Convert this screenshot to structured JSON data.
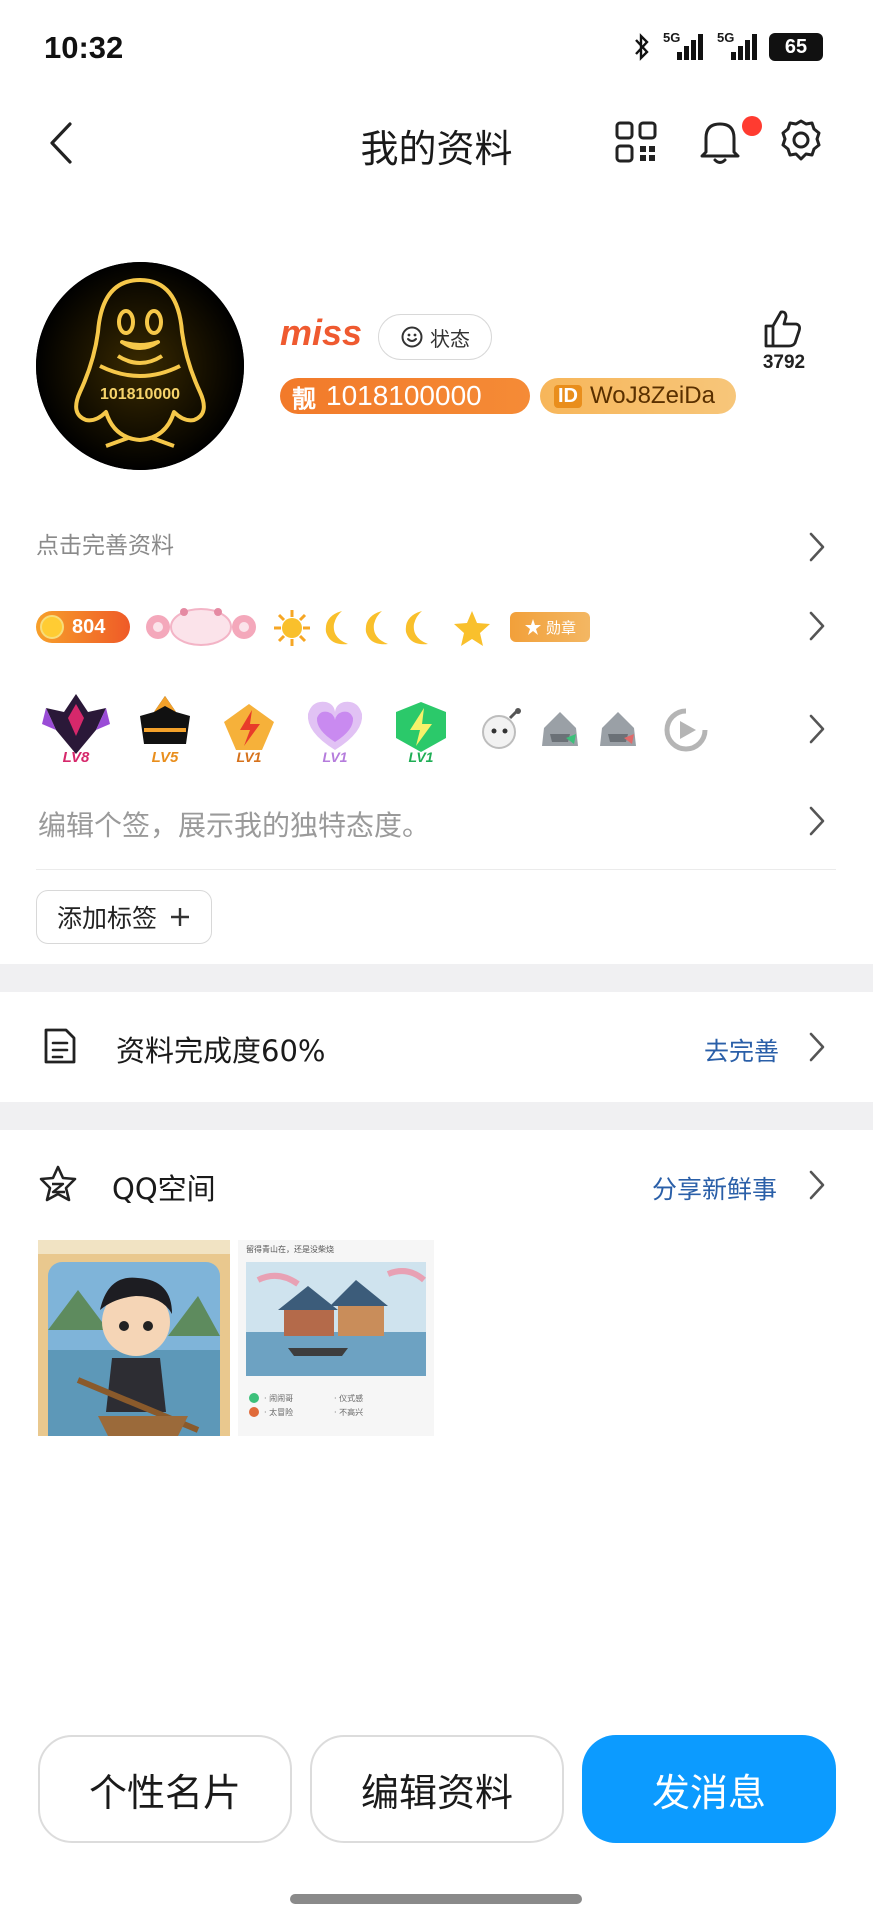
{
  "status_bar": {
    "time": "10:32",
    "net1": "5G",
    "net2": "5G",
    "battery": "65"
  },
  "nav": {
    "title": "我的资料"
  },
  "profile": {
    "nickname": "miss",
    "status_label": "状态",
    "pretty_tag": "靓",
    "pretty_number": "1018100000",
    "id_tag": "ID",
    "id_value": "WoJ8ZeiDa",
    "avatar_number": "101810000",
    "likes": "3792"
  },
  "complete_hint": "点击完善资料",
  "badges": {
    "coin_value": "804",
    "medal_label": "勋章"
  },
  "game_badges": [
    "LV8",
    "LV5",
    "LV1",
    "LV1",
    "LV1"
  ],
  "signature_placeholder": "编辑个签，展示我的独特态度。",
  "add_tag_label": "添加标签",
  "completion": {
    "label": "资料完成度60%",
    "action": "去完善"
  },
  "qzone": {
    "label": "QQ空间",
    "action": "分享新鲜事",
    "post2_caption": "留得青山在，还是没柴烧",
    "post2_legend": [
      "· 闹闹哥",
      "· 仪式感",
      "· 太冒险",
      "· 不高兴"
    ]
  },
  "bottom_buttons": {
    "card": "个性名片",
    "edit": "编辑资料",
    "message": "发消息"
  },
  "colors": {
    "accent": "#0c9bff",
    "link": "#2a5fa8",
    "nickname": "#ef5a30",
    "badge_orange": "#f27a2a",
    "alert": "#ff3b30"
  }
}
